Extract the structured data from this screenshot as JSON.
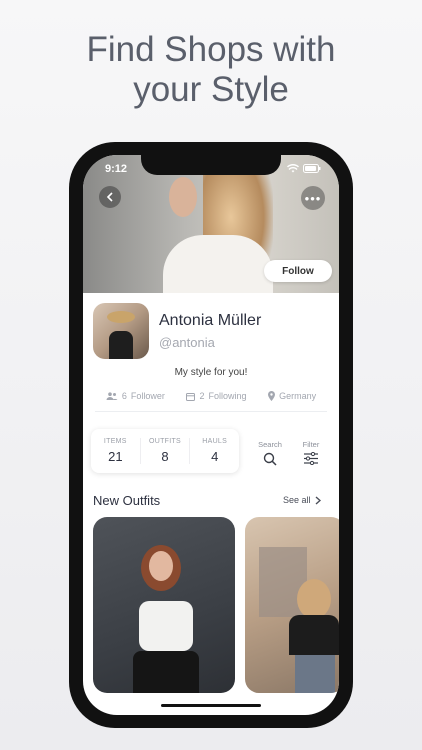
{
  "headline": {
    "line1": "Find Shops with",
    "line2": "your Style"
  },
  "status_bar": {
    "time": "9:12"
  },
  "profile": {
    "follow_label": "Follow",
    "name": "Antonia Müller",
    "handle": "@antonia",
    "bio": "My style for you!",
    "followers": {
      "count": "6",
      "label": "Follower"
    },
    "following": {
      "count": "2",
      "label": "Following"
    },
    "location": "Germany"
  },
  "counts": [
    {
      "label": "ITEMS",
      "value": "21"
    },
    {
      "label": "OUTFITS",
      "value": "8"
    },
    {
      "label": "HAULS",
      "value": "4"
    }
  ],
  "tools": {
    "search_label": "Search",
    "filter_label": "Filter"
  },
  "section": {
    "title": "New Outfits",
    "see_all": "See all"
  },
  "colors": {
    "text_dark": "#2d3140",
    "text_muted": "#a5a8b0",
    "headline": "#5a5f6b"
  }
}
